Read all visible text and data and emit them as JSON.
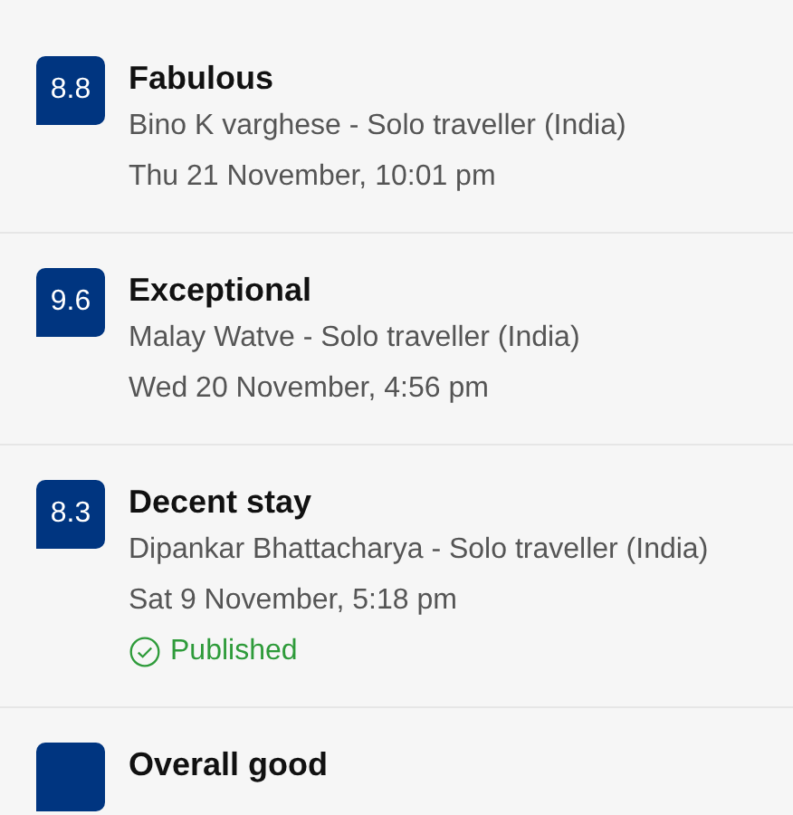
{
  "reviews": [
    {
      "score": "8.8",
      "title": "Fabulous",
      "reviewer": "Bino K varghese - Solo traveller (India)",
      "date": "Thu 21 November, 10:01 pm",
      "published": false
    },
    {
      "score": "9.6",
      "title": "Exceptional",
      "reviewer": "Malay Watve - Solo traveller (India)",
      "date": "Wed 20 November, 4:56 pm",
      "published": false
    },
    {
      "score": "8.3",
      "title": "Decent stay",
      "reviewer": "Dipankar Bhattacharya - Solo traveller (India)",
      "date": "Sat 9 November, 5:18 pm",
      "published": true,
      "status": "Published"
    },
    {
      "title": "Overall good"
    }
  ]
}
